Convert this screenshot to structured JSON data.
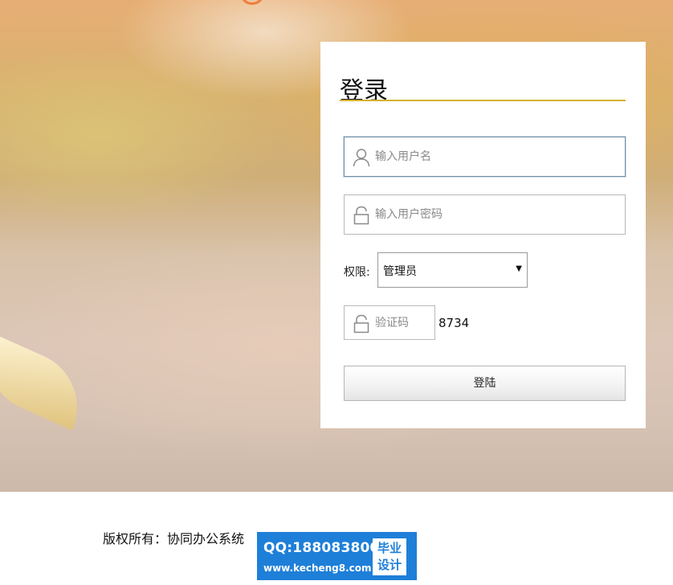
{
  "login": {
    "title": "登录",
    "username_placeholder": "输入用户名",
    "password_placeholder": "输入用户密码",
    "role_label": "权限:",
    "role_value": "管理员",
    "captcha_placeholder": "验证码",
    "captcha_code": "8734",
    "submit_label": "登陆"
  },
  "footer": {
    "copyright": "版权所有：协同办公系统"
  },
  "watermark": {
    "qq": "QQ:188083800",
    "url": "www.kecheng8.com",
    "badge_line1": "毕业",
    "badge_line2": "设计"
  },
  "icons": {
    "username": "user-icon",
    "password": "lock-icon",
    "captcha": "lock-icon",
    "select": "caret-down-icon"
  },
  "colors": {
    "title_underline": "#d6b12d",
    "watermark_bg": "#1e7fd8",
    "active_border": "#6e8fa7"
  }
}
